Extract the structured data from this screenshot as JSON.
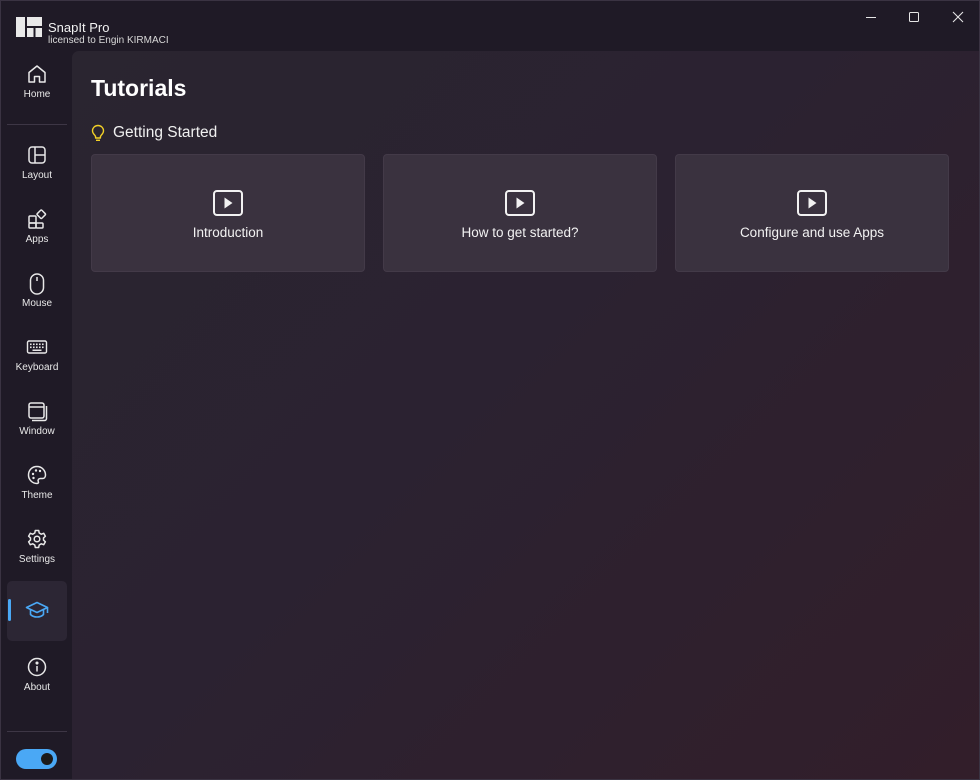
{
  "app": {
    "name": "SnapIt Pro",
    "license": "licensed to Engin KIRMACI"
  },
  "window_controls": [
    "minimize-icon",
    "maximize-icon",
    "close-icon"
  ],
  "sidebar": {
    "items": [
      {
        "label": "Home",
        "icon": "home-icon"
      },
      {
        "label": "Layout",
        "icon": "layout-icon"
      },
      {
        "label": "Apps",
        "icon": "apps-icon"
      },
      {
        "label": "Mouse",
        "icon": "mouse-icon"
      },
      {
        "label": "Keyboard",
        "icon": "keyboard-icon"
      },
      {
        "label": "Window",
        "icon": "window-icon"
      },
      {
        "label": "Theme",
        "icon": "palette-icon"
      },
      {
        "label": "Settings",
        "icon": "gear-icon"
      },
      {
        "label": "",
        "icon": "graduation-cap-icon",
        "active": true
      },
      {
        "label": "About",
        "icon": "info-icon"
      }
    ],
    "theme_toggle": {
      "on": true
    }
  },
  "main": {
    "title": "Tutorials",
    "section": {
      "icon": "lightbulb-icon",
      "title": "Getting Started",
      "cards": [
        {
          "label": "Introduction",
          "icon": "play-icon"
        },
        {
          "label": "How to get started?",
          "icon": "play-icon"
        },
        {
          "label": "Configure and use Apps",
          "icon": "play-icon"
        }
      ]
    }
  },
  "colors": {
    "accent": "#4aa8f5",
    "lightbulb": "#f2d027",
    "card_bg": "#3a323f"
  }
}
